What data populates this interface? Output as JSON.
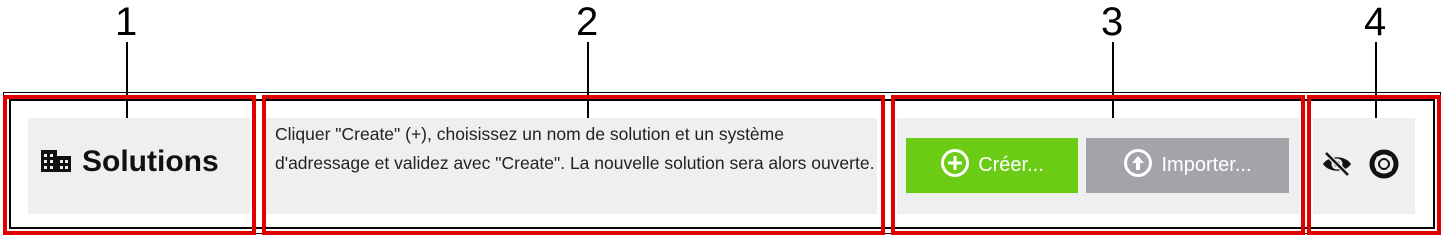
{
  "callouts": [
    "1",
    "2",
    "3",
    "4"
  ],
  "header": {
    "title": "Solutions",
    "title_icon": "building-icon"
  },
  "help": {
    "text": "Cliquer \"Create\" (+), choisissez un nom de solution et un système d'adressage et validez avec \"Create\". La nouvelle solution sera alors ouverte."
  },
  "actions": {
    "create_label": "Créer...",
    "create_icon": "plus-circle-icon",
    "import_label": "Importer...",
    "import_icon": "upload-circle-icon"
  },
  "tools": {
    "hide_icon": "eye-off-icon",
    "help_icon": "lifebuoy-icon"
  },
  "colors": {
    "highlight": "#e00000",
    "create_button": "#6ccb14",
    "import_button": "#a3a4a9",
    "panel": "#efefef"
  }
}
